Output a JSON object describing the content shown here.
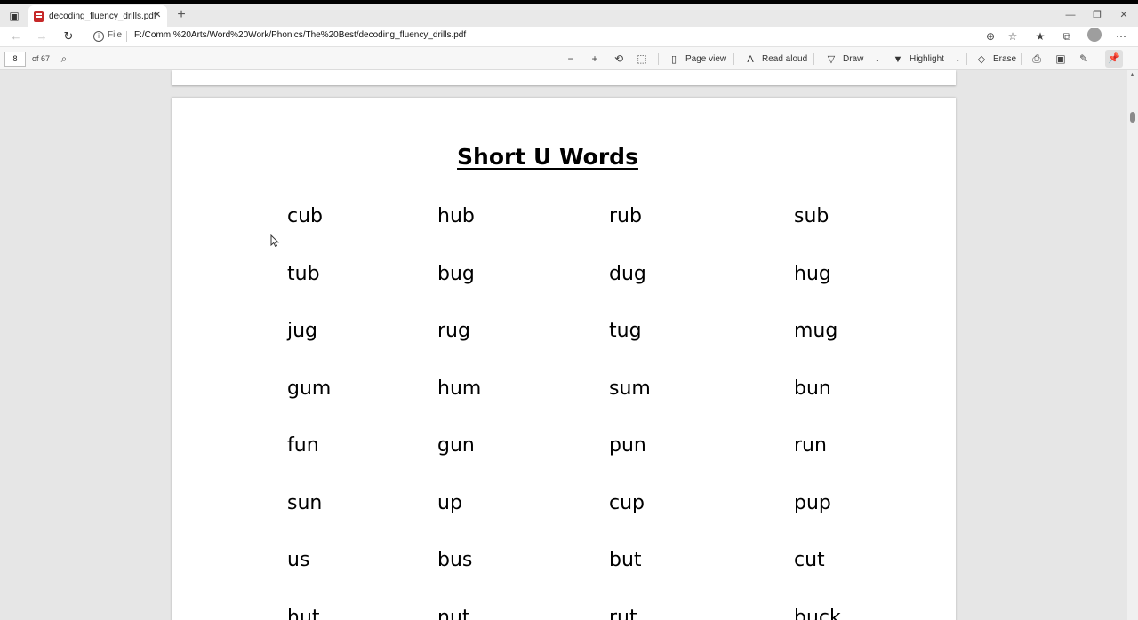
{
  "tab": {
    "title": "decoding_fluency_drills.pdf",
    "close": "✕",
    "new": "+"
  },
  "address": {
    "file_label": "File",
    "url": "F:/Comm.%20Arts/Word%20Work/Phonics/The%20Best/decoding_fluency_drills.pdf"
  },
  "pdf_toolbar": {
    "page": "8",
    "of_pages": "of 67",
    "page_view": "Page view",
    "read_aloud": "Read aloud",
    "draw": "Draw",
    "highlight": "Highlight",
    "erase": "Erase"
  },
  "document": {
    "title": "Short U Words",
    "rows": [
      [
        "cub",
        "hub",
        "rub",
        "sub"
      ],
      [
        "tub",
        "bug",
        "dug",
        "hug"
      ],
      [
        "jug",
        "rug",
        "tug",
        "mug"
      ],
      [
        "gum",
        "hum",
        "sum",
        "bun"
      ],
      [
        "fun",
        "gun",
        "pun",
        "run"
      ],
      [
        "sun",
        "up",
        "cup",
        "pup"
      ],
      [
        "us",
        "bus",
        "but",
        "cut"
      ],
      [
        "hut",
        "nut",
        "rut",
        "buck"
      ]
    ]
  }
}
